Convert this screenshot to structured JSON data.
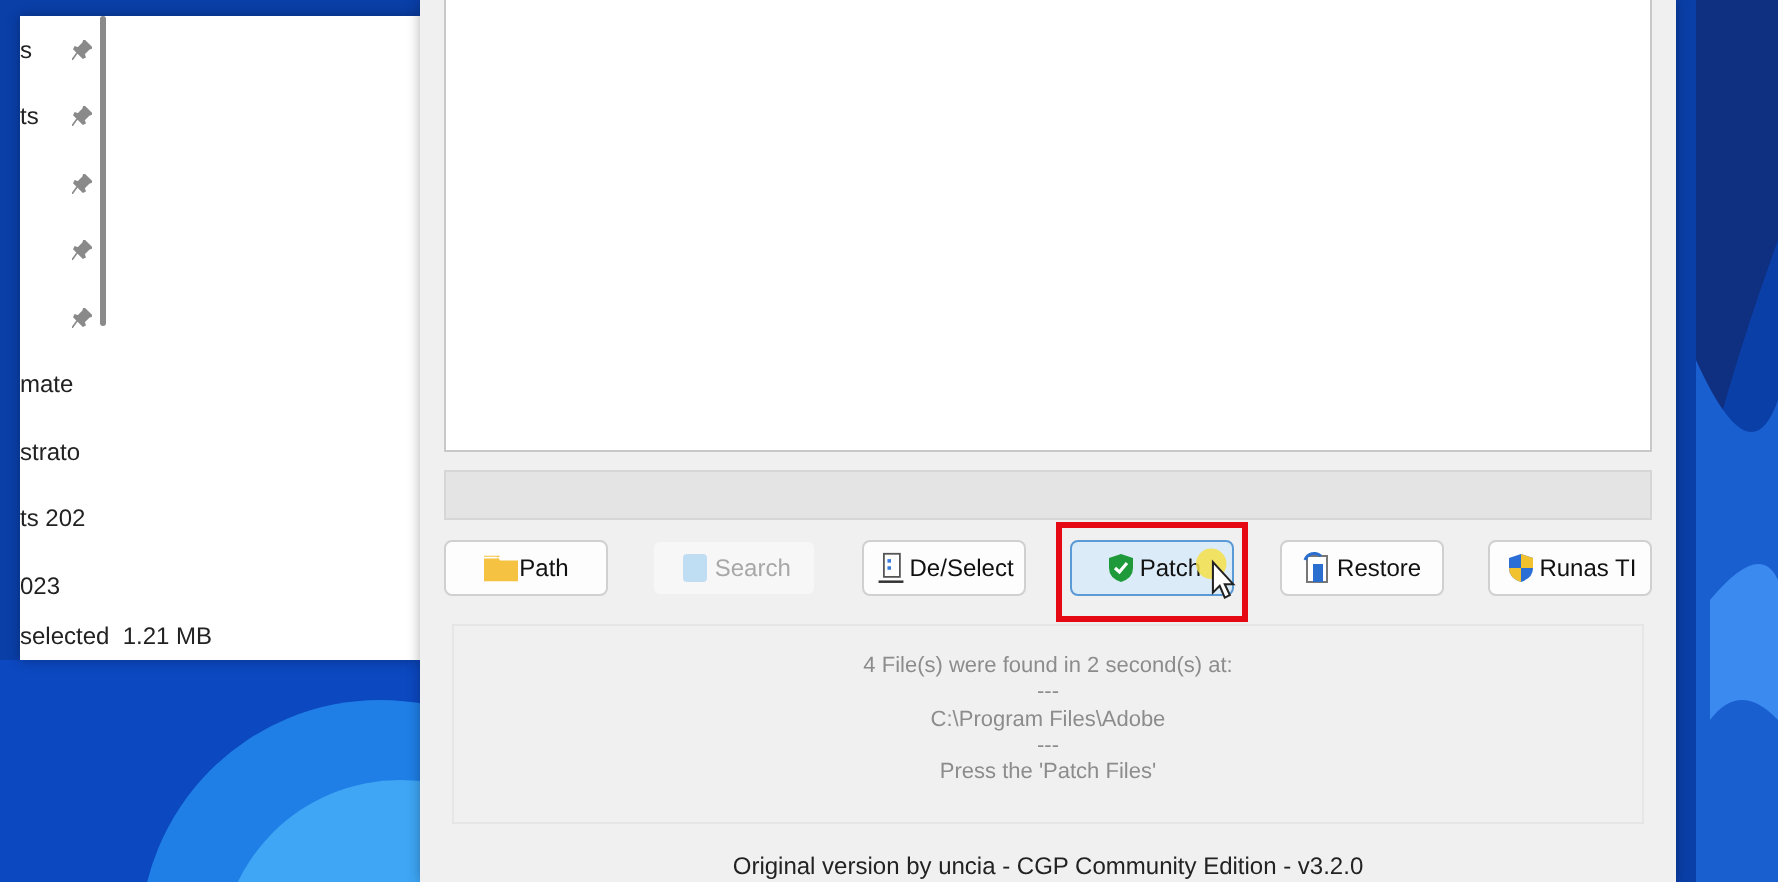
{
  "explorer": {
    "items": [
      {
        "label": "s",
        "pinned": true
      },
      {
        "label": "ts",
        "pinned": true
      },
      {
        "pinned": true
      },
      {
        "pinned": true
      },
      {
        "pinned": true
      },
      {
        "label": "mate",
        "pinned": false
      },
      {
        "label": "strato",
        "pinned": false
      },
      {
        "label": "ts 202",
        "pinned": false
      },
      {
        "label": "023",
        "pinned": false
      }
    ],
    "status": "selected  1.21 MB"
  },
  "patcher": {
    "progress": {
      "level": 0
    },
    "buttons": [
      {
        "label": "Path",
        "kind": "folder",
        "disabled": false,
        "selected": false
      },
      {
        "label": "Search",
        "kind": "search",
        "disabled": true,
        "selected": false
      },
      {
        "label": "De/Select",
        "kind": "list",
        "disabled": false,
        "selected": false
      },
      {
        "label": "Patch",
        "kind": "shield",
        "disabled": false,
        "selected": true
      },
      {
        "label": "Restore",
        "kind": "restore",
        "disabled": false,
        "selected": false
      },
      {
        "label": "Runas TI",
        "kind": "uac",
        "disabled": false,
        "selected": false
      }
    ],
    "log": [
      "4 File(s) were found in 2 second(s) at:",
      "---",
      "C:\\Program Files\\Adobe",
      "---",
      "Press the 'Patch Files'"
    ],
    "footer": "Original version by uncia - CGP Community Edition - v3.2.0"
  }
}
